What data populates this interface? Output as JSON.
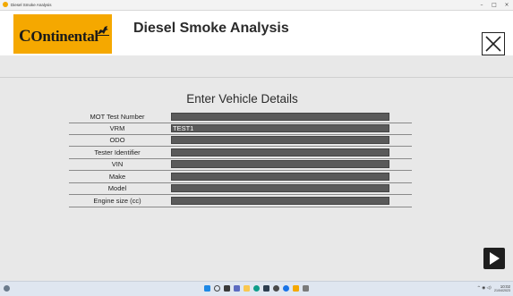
{
  "window": {
    "title": "Diesel Smoke Analysis",
    "minimize_glyph": "–",
    "maximize_glyph": "□",
    "close_glyph": "×"
  },
  "header": {
    "logo_text": "Ontinental",
    "logo_letter": "C",
    "logo_mark": "horse-icon",
    "app_title": "Diesel Smoke Analysis",
    "close_icon": "close-icon"
  },
  "form": {
    "title": "Enter Vehicle Details",
    "fields": [
      {
        "label": "MOT Test Number",
        "value": ""
      },
      {
        "label": "VRM",
        "value": "TEST1"
      },
      {
        "label": "ODO",
        "value": ""
      },
      {
        "label": "Tester Identifier",
        "value": ""
      },
      {
        "label": "VIN",
        "value": ""
      },
      {
        "label": "Make",
        "value": ""
      },
      {
        "label": "Model",
        "value": ""
      },
      {
        "label": "Engine size (cc)",
        "value": ""
      }
    ],
    "next_icon": "play-next-icon"
  },
  "taskbar": {
    "time": "10:02",
    "date": "21/04/2023"
  },
  "colors": {
    "brand": "#f5a800",
    "field_bg": "#5a5a5a",
    "page_bg": "#e8e8e8"
  }
}
